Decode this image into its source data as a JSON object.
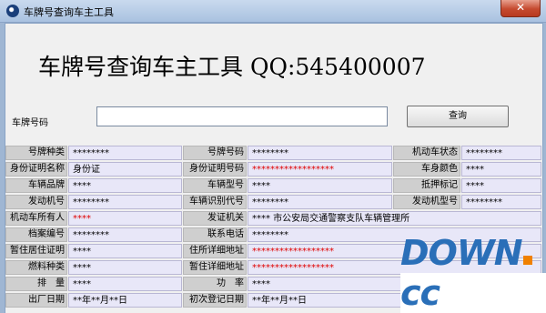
{
  "window": {
    "title": "车牌号查询车主工具",
    "close_glyph": "✕"
  },
  "banner": "车牌号查询车主工具 QQ:545400007",
  "plate": {
    "label": "车牌号码",
    "value": "",
    "placeholder": ""
  },
  "query_button": "查询",
  "rows": [
    [
      {
        "label": "号牌种类",
        "value": "********"
      },
      {
        "label": "号牌号码",
        "value": "********"
      },
      {
        "label": "机动车状态",
        "value": "********"
      }
    ],
    [
      {
        "label": "身份证明名称",
        "value": "身份证"
      },
      {
        "label": "身份证明号码",
        "value": "******************"
      },
      {
        "label": "车身颜色",
        "value": "****"
      }
    ],
    [
      {
        "label": "车辆品牌",
        "value": "****"
      },
      {
        "label": "车辆型号",
        "value": "****"
      },
      {
        "label": "抵押标记",
        "value": "****"
      }
    ],
    [
      {
        "label": "发动机号",
        "value": "********"
      },
      {
        "label": "车辆识别代号",
        "value": "********"
      },
      {
        "label": "发动机型号",
        "value": "********"
      }
    ],
    [
      {
        "label": "机动车所有人",
        "value": "****"
      },
      {
        "label": "发证机关",
        "value": "**** 市公安局交通警察支队车辆管理所"
      }
    ],
    [
      {
        "label": "档案编号",
        "value": "********"
      },
      {
        "label": "联系电话",
        "value": "********"
      }
    ],
    [
      {
        "label": "暂住居住证明",
        "value": "****"
      },
      {
        "label": "住所详细地址",
        "value": "******************"
      }
    ],
    [
      {
        "label": "燃料种类",
        "value": "****"
      },
      {
        "label": "暂住详细地址",
        "value": "******************"
      }
    ],
    [
      {
        "label": "排　量",
        "value": "****"
      },
      {
        "label": "功　率",
        "value": "****"
      }
    ],
    [
      {
        "label": "出厂日期",
        "value": "**年**月**日"
      },
      {
        "label": "初次登记日期",
        "value": "**年**月**日"
      }
    ]
  ],
  "watermark": {
    "main": "DOWN",
    "suffix": "cc"
  },
  "colors": {
    "red_value": "#e00000",
    "label_bg": "#cfcfcf",
    "value_bg": "#e8e7f8",
    "watermark": "#2a6fb8",
    "watermark_dot": "#f08000"
  }
}
